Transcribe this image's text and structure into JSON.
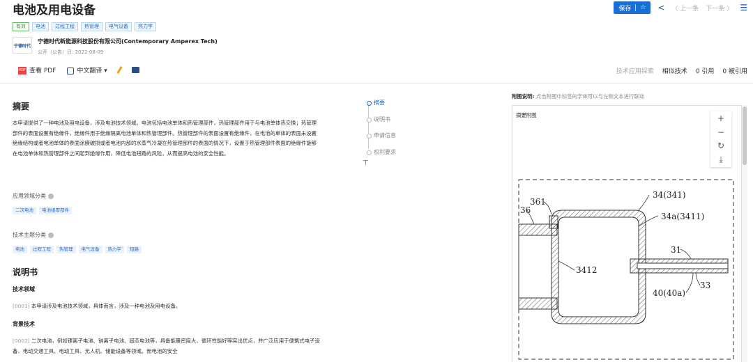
{
  "header": {
    "title": "电池及用电设备",
    "status_tag": "有效",
    "tags": [
      "电池",
      "过程工程",
      "热管理",
      "电气设备",
      "热力学"
    ],
    "logo_text": "宁德时代",
    "company": "宁德时代新能源科技股份有限公司(Contemporary Amperex Tech)",
    "pubinfo": "公开（公告）日: 2022-08-09"
  },
  "topbar": {
    "save": "保存",
    "star": "☆",
    "share_icon": "share-icon",
    "prev": "〈 上一条",
    "next": "下一条 〉",
    "list_icon": "list-icon"
  },
  "toolbar": {
    "pdf_icon_text": "PDF",
    "view_pdf": "查看 PDF",
    "translate": "中文翻译 ▾"
  },
  "rightlinks": {
    "tech_explore": "技术应用探索",
    "similar": "相似技术",
    "cited": "0 引用",
    "cited_by": "0 被引用"
  },
  "abstract": {
    "heading": "摘要",
    "text": "本申请提供了一种电池及用电设备，涉及电池技术领域。电池包括电池单体和热管理部件，热管理部件用于与电池单体热交换；热管理部件的表面设置有绝缘件，绝缘件用于绝缘隔离电池单体和热管理部件。热管理部件的表面设置有绝缘件，在电池的单体的表面未设置绝缘结构或者电池单体的表面涂膜破损或者电池内部的水蒸气冷凝在热管理部件的表面的情况下，设置于热管理部件表面的绝缘件能够在电池单体和热管理部件之间起到绝缘作用，降低电池短路的风险，从而提高电池的安全性能。"
  },
  "application": {
    "label": "应用领域分类",
    "chips": [
      "二次电池",
      "电池组零部件"
    ]
  },
  "topic": {
    "label": "技术主题分类",
    "chips": [
      "电池",
      "过程工程",
      "热管理",
      "电气设备",
      "热力学",
      "短路"
    ]
  },
  "description": {
    "heading": "说明书",
    "field_heading": "技术领域",
    "p1_num": "[0001]",
    "p1_text": "本申请涉及电池技术领域，具体而言，涉及一种电池及用电设备。",
    "bg_heading": "背景技术",
    "p2_num": "[0002]",
    "p2_text": "二次电池，例如锂离子电池、钠离子电池、固态电池等，具备能量密度大、循环性能好等突出优点，并广泛应用于便携式电子设备、电动交通工具、电动工具、无人机、储能设备等领域。而电池的安全"
  },
  "outline": {
    "items": [
      "摘要",
      "说明书",
      "申请信息",
      "权利要求"
    ],
    "totop": "⊤"
  },
  "figure": {
    "note_bold": "附图说明:",
    "note": "点击附图中标签的字体可以与左侧文本进行联动",
    "label": "摘要附图",
    "zoom_in": "+",
    "zoom_out": "−",
    "rotate": "↻",
    "download": "⤓",
    "labels": [
      "361",
      "36",
      "34(341)",
      "34a(3411)",
      "31",
      "3412",
      "33",
      "40(40a)"
    ]
  },
  "colors": {
    "accent": "#1a6fd4",
    "tag_blue": "#2a6fbd",
    "status_green": "#3b8f3b"
  }
}
